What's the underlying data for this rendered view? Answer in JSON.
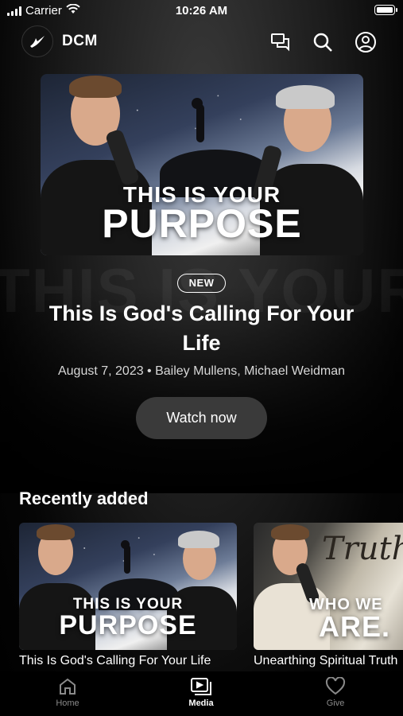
{
  "status_bar": {
    "carrier": "Carrier",
    "time": "10:26 AM"
  },
  "header": {
    "brand": "DCM",
    "icons": [
      "chat-icon",
      "search-icon",
      "profile-icon"
    ]
  },
  "hero": {
    "thumbnail_text_line1": "THIS IS YOUR",
    "thumbnail_text_line2": "PURPOSE",
    "badge": "NEW",
    "title": "This Is God's Calling For Your Life",
    "meta": "August 7, 2023 • Bailey Mullens, Michael Weidman",
    "button_label": "Watch now",
    "background_text": "THIS IS YOUR PURPOSE"
  },
  "recently_added": {
    "title": "Recently added",
    "items": [
      {
        "thumb_line1": "THIS IS YOUR",
        "thumb_line2": "PURPOSE",
        "label": "This Is God's Calling For Your Life"
      },
      {
        "thumb_line1": "WHO WE",
        "thumb_line2": "ARE.",
        "thumb_script": "Truth",
        "label": "Unearthing Spiritual Truth"
      }
    ]
  },
  "tabbar": {
    "tabs": [
      {
        "label": "Home",
        "icon": "home-icon",
        "active": false
      },
      {
        "label": "Media",
        "icon": "media-icon",
        "active": true
      },
      {
        "label": "Give",
        "icon": "heart-icon",
        "active": false
      }
    ]
  },
  "colors": {
    "background": "#000000",
    "button_bg": "#3a3a3a",
    "inactive_tab": "#8a8a8a",
    "text": "#ffffff"
  }
}
